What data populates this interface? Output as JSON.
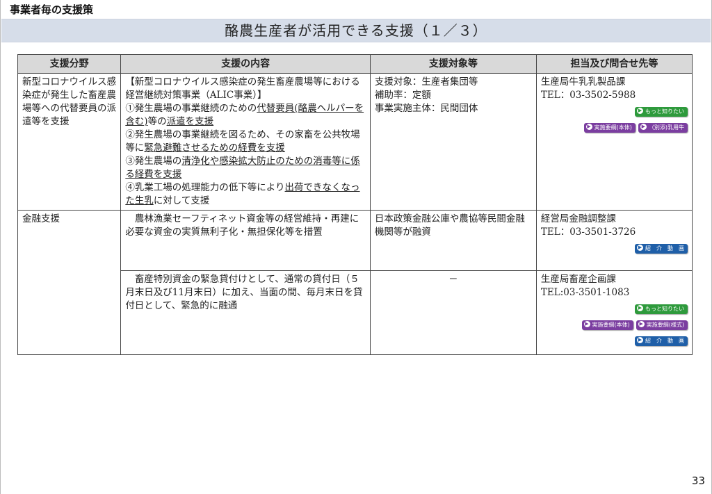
{
  "section_label": "事業者毎の支援策",
  "title": "酪農生産者が活用できる支援（１／３）",
  "headers": [
    "支援分野",
    "支援の内容",
    "支援対象等",
    "担当及び問合せ先等"
  ],
  "row1": {
    "field": "新型コロナウイルス感染症が発生した畜産農場等への代替要員の派遣等を支援",
    "content": {
      "heading": "【新型コロナウイルス感染症の発生畜産農場等における経営継続対策事業（ALIC事業）】",
      "item1_plain": "①発生農場の事業継続のための",
      "item1_ul": "代替要員(酪農ヘルパーを含む)",
      "item1_plain2": "等の",
      "item1_ul2": "派遣を支援",
      "item2_plain": "②発生農場の事業継続を図るため、その家畜を公共牧場等に",
      "item2_ul": "緊急避難させるための経費を支援",
      "item3_plain": "③発生農場の",
      "item3_ul": "清浄化や感染拡大防止のための消毒等に係る経費を支援",
      "item4_plain": "④乳業工場の処理能力の低下等により",
      "item4_ul": "出荷できなくなった生乳",
      "item4_plain2": "に対して支援"
    },
    "target": {
      "line1": "支援対象：生産者集団等",
      "line2": "補助率：定額",
      "line3": "事業実施主体：民間団体"
    },
    "contact": {
      "dept": "生産局牛乳乳製品課",
      "tel": "TEL：03-3502-5988",
      "btn_more": "もっと知りたい",
      "btn_guide": "実施要綱(本体)",
      "btn_separate": "（別添)乳用牛"
    }
  },
  "row2": {
    "field": "金融支援",
    "content": "農林漁業セーフティネット資金等の経営維持・再建に必要な資金の実質無利子化・無担保化等を措置",
    "target": "日本政策金融公庫や農協等民間金融機関等が融資",
    "contact": {
      "dept": "経営局金融調整課",
      "tel": "TEL：03-3501-3726",
      "btn_video": "紹　介　動　画"
    }
  },
  "row3": {
    "content": "畜産特別資金の緊急貸付けとして、通常の貸付日（５月末日及び11月末日）に加え、当面の間、毎月末日を貸付日として、緊急的に融通",
    "target": "－",
    "contact": {
      "dept": "生産局畜産企画課",
      "tel": "TEL:03-3501-1083",
      "btn_more": "もっと知りたい",
      "btn_guide": "実施要綱(本体)",
      "btn_form": "実施要綱(様式)",
      "btn_video": "紹　介　動　画"
    }
  },
  "page_number": "33",
  "colors": {
    "title_band": "#d6dde9",
    "header_bg": "#d9d9d9",
    "btn_green": "#2e9a3c",
    "btn_purple": "#7b3ea0",
    "btn_blue": "#1f5fa8"
  },
  "icons": {
    "button_icon": "arrow-right-circle-icon"
  }
}
